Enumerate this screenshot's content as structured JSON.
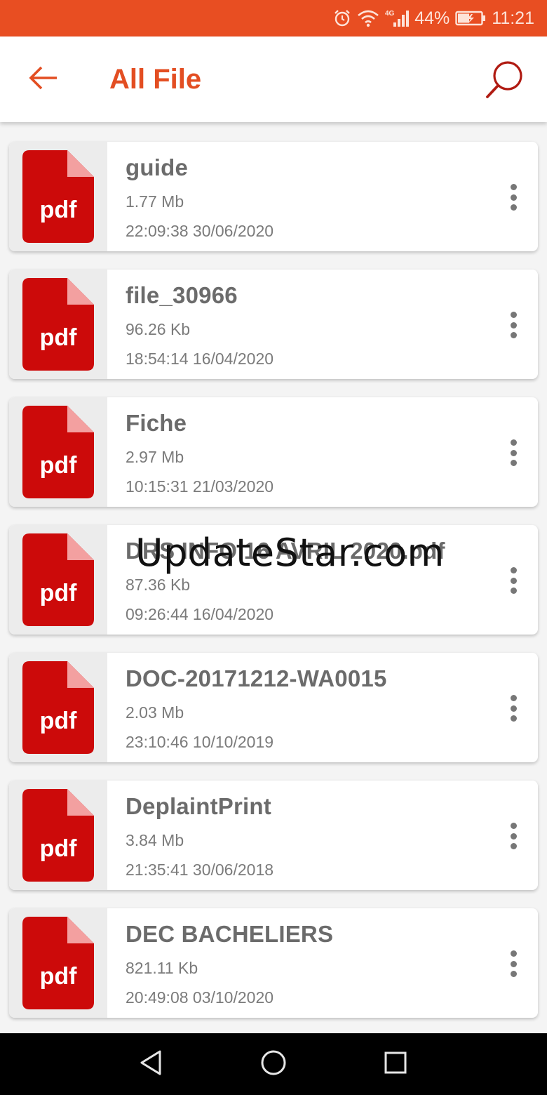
{
  "status_bar": {
    "icons": [
      "alarm-icon",
      "wifi-icon",
      "signal-4g-icon",
      "battery-charging-icon"
    ],
    "network": "4G",
    "battery": "44%",
    "time": "11:21"
  },
  "header": {
    "back_icon": "arrow-left-icon",
    "title": "All File",
    "search_icon": "search-icon"
  },
  "colors": {
    "status_bar": "#e84e22",
    "accent": "#e34e22",
    "pdf_red": "#cc0a0a",
    "pdf_fold": "#f3a0a0"
  },
  "files": [
    {
      "name": "guide",
      "size": "1.77 Mb",
      "date": "22:09:38 30/06/2020",
      "icon_text": "pdf"
    },
    {
      "name": "file_30966",
      "size": "96.26 Kb",
      "date": "18:54:14 16/04/2020",
      "icon_text": "pdf"
    },
    {
      "name": "Fiche",
      "size": "2.97 Mb",
      "date": "10:15:31 21/03/2020",
      "icon_text": "pdf"
    },
    {
      "name": "DRS INFO 16 AVRIL 2020.pdf",
      "size": "87.36 Kb",
      "date": "09:26:44 16/04/2020",
      "icon_text": "pdf"
    },
    {
      "name": "DOC-20171212-WA0015",
      "size": "2.03 Mb",
      "date": "23:10:46 10/10/2019",
      "icon_text": "pdf"
    },
    {
      "name": "DeplaintPrint",
      "size": "3.84 Mb",
      "date": "21:35:41 30/06/2018",
      "icon_text": "pdf"
    },
    {
      "name": "DEC BACHELIERS",
      "size": "821.11 Kb",
      "date": "20:49:08 03/10/2020",
      "icon_text": "pdf"
    }
  ],
  "watermark": "UpdateStar.com",
  "nav_bar": {
    "icons": [
      "back-triangle-icon",
      "home-circle-icon",
      "recents-square-icon"
    ]
  }
}
